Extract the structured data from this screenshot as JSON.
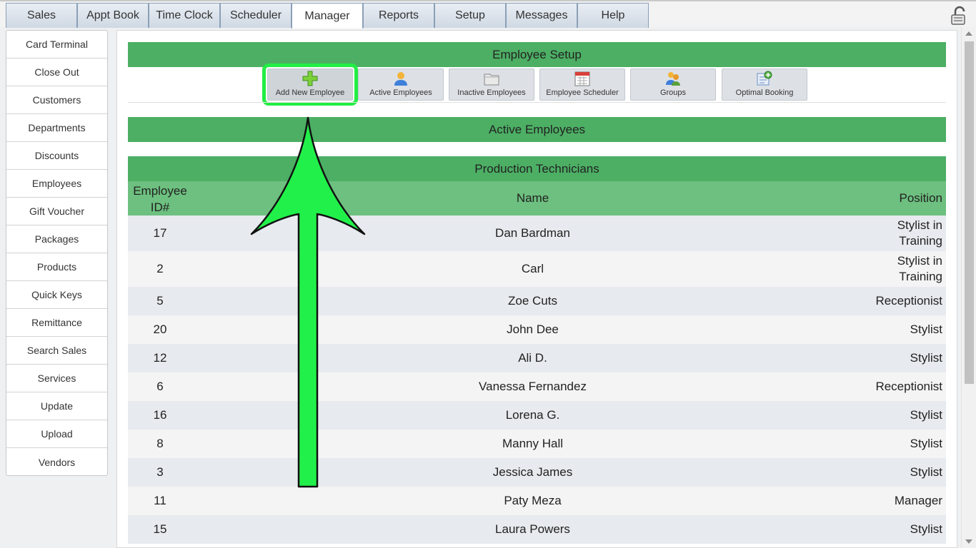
{
  "tabs": [
    {
      "label": "Sales",
      "active": false
    },
    {
      "label": "Appt Book",
      "active": false
    },
    {
      "label": "Time Clock",
      "active": false
    },
    {
      "label": "Scheduler",
      "active": false
    },
    {
      "label": "Manager",
      "active": true
    },
    {
      "label": "Reports",
      "active": false
    },
    {
      "label": "Setup",
      "active": false
    },
    {
      "label": "Messages",
      "active": false
    },
    {
      "label": "Help",
      "active": false
    }
  ],
  "sidebar": {
    "items": [
      "Card Terminal",
      "Close Out",
      "Customers",
      "Departments",
      "Discounts",
      "Employees",
      "Gift Voucher",
      "Packages",
      "Products",
      "Quick Keys",
      "Remittance",
      "Search Sales",
      "Services",
      "Update",
      "Upload",
      "Vendors"
    ]
  },
  "main": {
    "setup_title": "Employee Setup",
    "toolbar": [
      {
        "label": "Add New Employee",
        "icon": "plus-icon",
        "highlighted": true
      },
      {
        "label": "Active Employees",
        "icon": "person-icon",
        "highlighted": false
      },
      {
        "label": "Inactive Employees",
        "icon": "folder-icon",
        "highlighted": false
      },
      {
        "label": "Employee Scheduler",
        "icon": "calendar-icon",
        "highlighted": false
      },
      {
        "label": "Groups",
        "icon": "group-icon",
        "highlighted": false
      },
      {
        "label": "Optimal Booking",
        "icon": "optimal-booking-icon",
        "highlighted": false
      }
    ],
    "section_title": "Active Employees",
    "group_title": "Production Technicians",
    "columns": {
      "id": "Employee ID#",
      "name": "Name",
      "position": "Position"
    },
    "rows": [
      {
        "id": "17",
        "name": "Dan Bardman",
        "position": "Stylist in Training"
      },
      {
        "id": "2",
        "name": "Carl",
        "position": "Stylist in Training"
      },
      {
        "id": "5",
        "name": "Zoe Cuts",
        "position": "Receptionist"
      },
      {
        "id": "20",
        "name": "John Dee",
        "position": "Stylist"
      },
      {
        "id": "12",
        "name": "Ali D.",
        "position": "Stylist"
      },
      {
        "id": "6",
        "name": "Vanessa Fernandez",
        "position": "Receptionist"
      },
      {
        "id": "16",
        "name": "Lorena G.",
        "position": "Stylist"
      },
      {
        "id": "8",
        "name": "Manny Hall",
        "position": "Stylist"
      },
      {
        "id": "3",
        "name": "Jessica James",
        "position": "Stylist"
      },
      {
        "id": "11",
        "name": "Paty Meza",
        "position": "Manager"
      },
      {
        "id": "15",
        "name": "Laura Powers",
        "position": "Stylist"
      }
    ]
  },
  "colors": {
    "header_green": "#4caf64",
    "subheader_green": "#6dc07f",
    "highlight_green": "#22ee44"
  }
}
